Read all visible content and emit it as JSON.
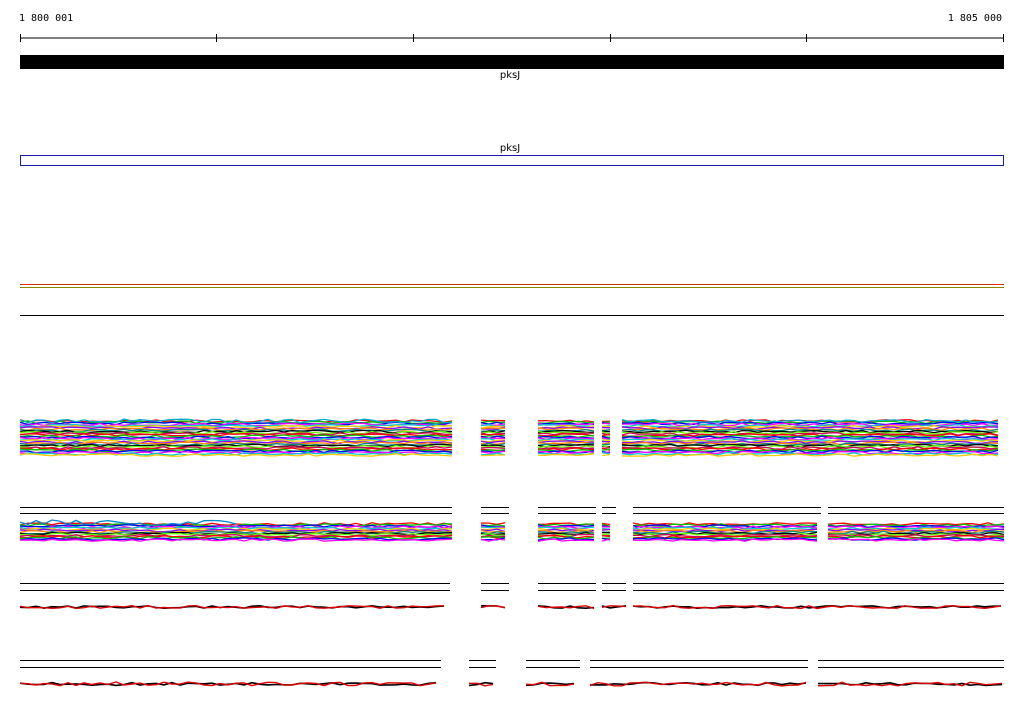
{
  "ruler": {
    "start_label": "1 800 001",
    "end_label": "1 805 000"
  },
  "gene_track": {
    "feature_label": "pksJ",
    "fill_color": "#000000"
  },
  "transcript_track": {
    "feature_label": "pksJ",
    "outline_color": "#1a1aa8"
  },
  "signal_colors": [
    "#ff0000",
    "#00c000",
    "#0000ff",
    "#ff00ff",
    "#00cccc",
    "#ffcc00",
    "#8800ff",
    "#ff8800",
    "#008888",
    "#000000",
    "#66ff00",
    "#cc0066"
  ]
}
